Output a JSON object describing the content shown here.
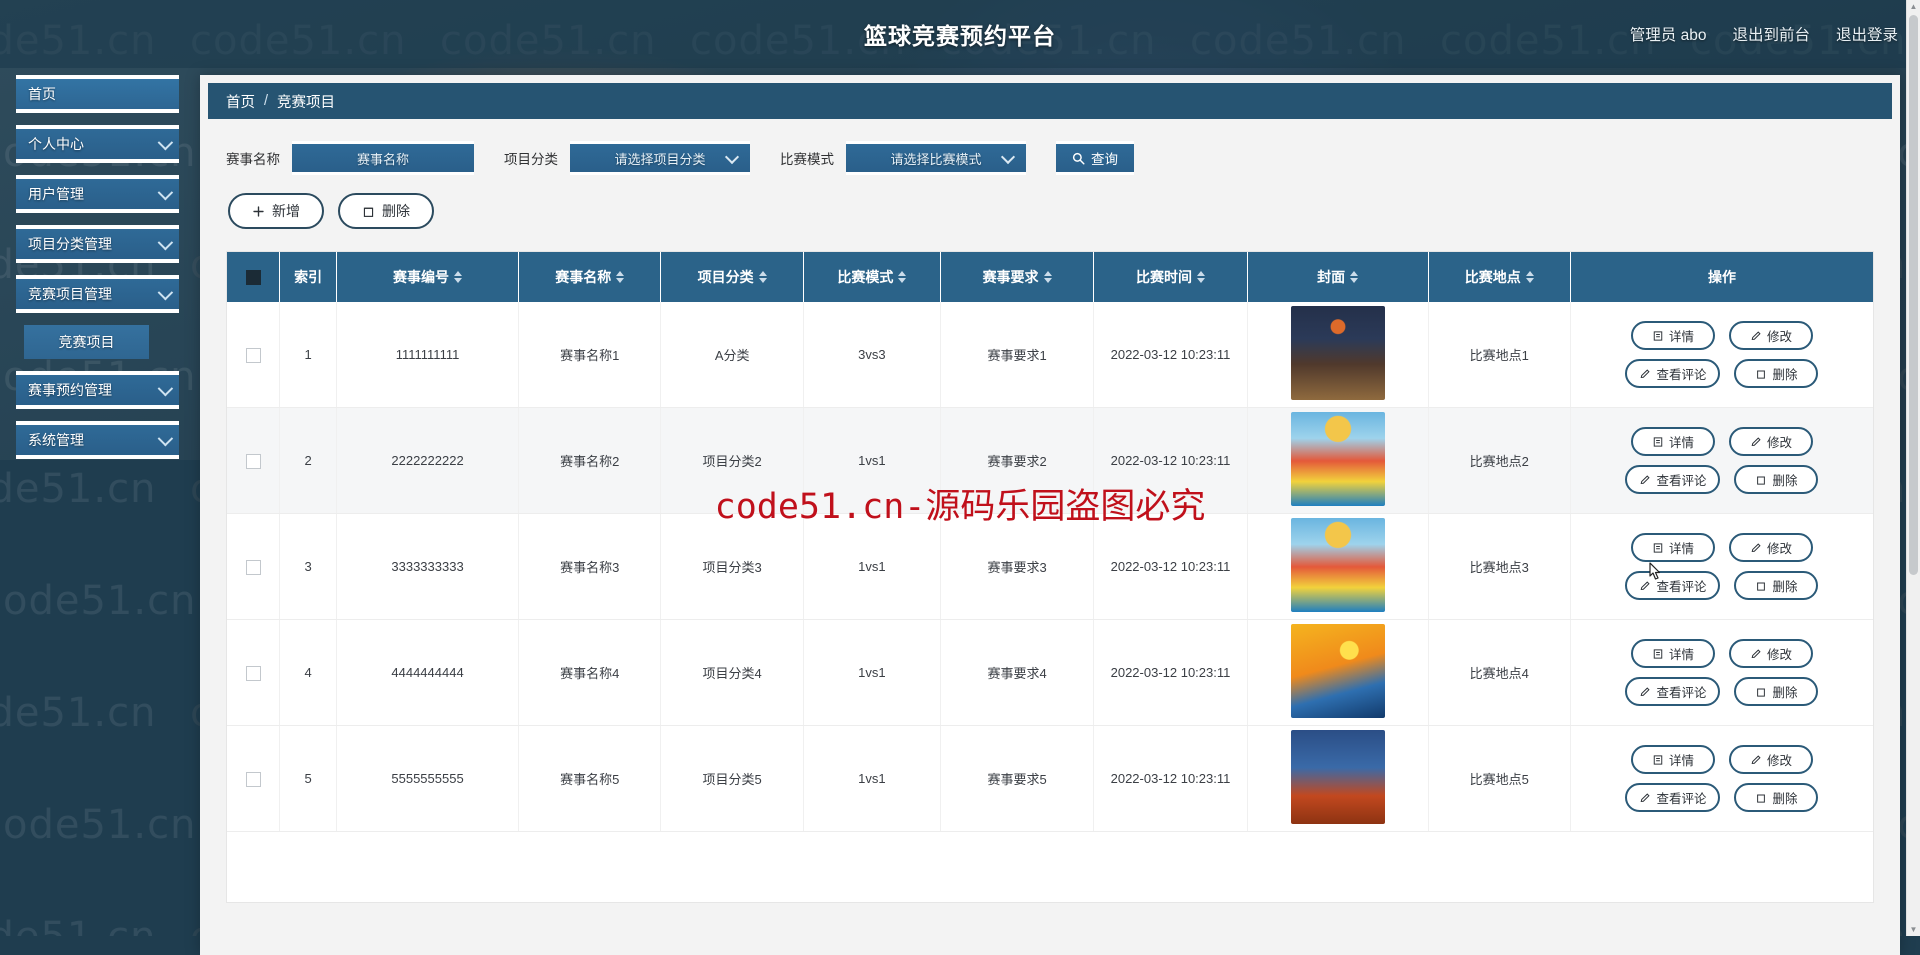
{
  "header": {
    "title": "篮球竞赛预约平台",
    "user_label": "管理员 abo",
    "exit_front_label": "退出到前台",
    "logout_label": "退出登录"
  },
  "sidebar": {
    "items": [
      {
        "label": "首页",
        "has_children": false
      },
      {
        "label": "个人中心",
        "has_children": true
      },
      {
        "label": "用户管理",
        "has_children": true
      },
      {
        "label": "项目分类管理",
        "has_children": true
      },
      {
        "label": "竞赛项目管理",
        "has_children": true
      }
    ],
    "sub_item": {
      "label": "竞赛项目"
    },
    "items_after": [
      {
        "label": "赛事预约管理",
        "has_children": true
      },
      {
        "label": "系统管理",
        "has_children": true
      }
    ]
  },
  "breadcrumb": {
    "home": "首页",
    "sep": "/",
    "current": "竞赛项目"
  },
  "search": {
    "name_label": "赛事名称",
    "name_placeholder": "赛事名称",
    "category_label": "项目分类",
    "category_placeholder": "请选择项目分类",
    "mode_label": "比赛模式",
    "mode_placeholder": "请选择比赛模式",
    "query_label": "查询"
  },
  "toolbar": {
    "add_label": "新增",
    "delete_label": "删除"
  },
  "table": {
    "columns": [
      {
        "label": "索引",
        "sortable": false
      },
      {
        "label": "赛事编号",
        "sortable": true
      },
      {
        "label": "赛事名称",
        "sortable": true
      },
      {
        "label": "项目分类",
        "sortable": true
      },
      {
        "label": "比赛模式",
        "sortable": true
      },
      {
        "label": "赛事要求",
        "sortable": true
      },
      {
        "label": "比赛时间",
        "sortable": true
      },
      {
        "label": "封面",
        "sortable": true
      },
      {
        "label": "比赛地点",
        "sortable": true
      },
      {
        "label": "操作",
        "sortable": false
      }
    ],
    "rows": [
      {
        "index": "1",
        "code": "1111111111",
        "name": "赛事名称1",
        "category": "A分类",
        "mode": "3vs3",
        "require": "赛事要求1",
        "time": "2022-03-12 10:23:11",
        "place": "比赛地点1"
      },
      {
        "index": "2",
        "code": "2222222222",
        "name": "赛事名称2",
        "category": "项目分类2",
        "mode": "1vs1",
        "require": "赛事要求2",
        "time": "2022-03-12 10:23:11",
        "place": "比赛地点2"
      },
      {
        "index": "3",
        "code": "3333333333",
        "name": "赛事名称3",
        "category": "项目分类3",
        "mode": "1vs1",
        "require": "赛事要求3",
        "time": "2022-03-12 10:23:11",
        "place": "比赛地点3"
      },
      {
        "index": "4",
        "code": "4444444444",
        "name": "赛事名称4",
        "category": "项目分类4",
        "mode": "1vs1",
        "require": "赛事要求4",
        "time": "2022-03-12 10:23:11",
        "place": "比赛地点4"
      },
      {
        "index": "5",
        "code": "5555555555",
        "name": "赛事名称5",
        "category": "项目分类5",
        "mode": "1vs1",
        "require": "赛事要求5",
        "time": "2022-03-12 10:23:11",
        "place": "比赛地点5"
      }
    ],
    "ops": {
      "detail_label": "详情",
      "edit_label": "修改",
      "comment_label": "查看评论",
      "delete_label": "删除"
    }
  },
  "watermarks": {
    "tile_text": "code51.cn",
    "center_text": "code51.cn-源码乐园盗图必究",
    "center_color": "#c0101b"
  },
  "colors": {
    "brand_dark": "#1f3d4f",
    "brand_blue": "#2b6389",
    "panel_bg": "#f3f3f3",
    "accent_button": "#2f6a97"
  }
}
